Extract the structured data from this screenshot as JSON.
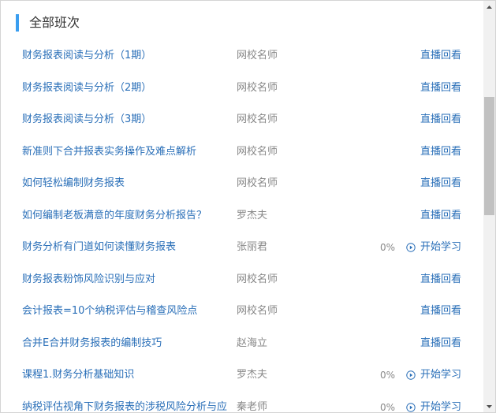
{
  "header": {
    "title": "全部班次"
  },
  "courses": [
    {
      "title": "财务报表阅读与分析（1期）",
      "teacher": "网校名师",
      "progress": "",
      "action": "直播回看",
      "action_type": "replay"
    },
    {
      "title": "财务报表阅读与分析（2期）",
      "teacher": "网校名师",
      "progress": "",
      "action": "直播回看",
      "action_type": "replay"
    },
    {
      "title": "财务报表阅读与分析（3期）",
      "teacher": "网校名师",
      "progress": "",
      "action": "直播回看",
      "action_type": "replay"
    },
    {
      "title": "新准则下合并报表实务操作及难点解析",
      "teacher": "网校名师",
      "progress": "",
      "action": "直播回看",
      "action_type": "replay"
    },
    {
      "title": "如何轻松编制财务报表",
      "teacher": "网校名师",
      "progress": "",
      "action": "直播回看",
      "action_type": "replay"
    },
    {
      "title": "如何编制老板满意的年度财务分析报告？",
      "teacher": "罗杰夫",
      "progress": "",
      "action": "直播回看",
      "action_type": "replay"
    },
    {
      "title": "财务分析有门道如何读懂财务报表",
      "teacher": "张丽君",
      "progress": "0%",
      "action": "开始学习",
      "action_type": "start"
    },
    {
      "title": "财务报表粉饰风险识别与应对",
      "teacher": "网校名师",
      "progress": "",
      "action": "直播回看",
      "action_type": "replay"
    },
    {
      "title": "会计报表=10个纳税评估与稽查风险点",
      "teacher": "网校名师",
      "progress": "",
      "action": "直播回看",
      "action_type": "replay"
    },
    {
      "title": "合并E合并财务报表的编制技巧",
      "teacher": "赵海立",
      "progress": "",
      "action": "直播回看",
      "action_type": "replay"
    },
    {
      "title": "课程1.财务分析基础知识",
      "teacher": "罗杰夫",
      "progress": "0%",
      "action": "开始学习",
      "action_type": "start"
    },
    {
      "title": "纳税评估视角下财务报表的涉税风险分析与应",
      "teacher": "秦老师",
      "progress": "0%",
      "action": "开始学习",
      "action_type": "start"
    }
  ],
  "colors": {
    "accent": "#3a9ef0",
    "link": "#2a6fb8",
    "muted": "#888888"
  },
  "icons": {
    "start": "play-circle-icon",
    "scroll_up": "triangle-up-icon",
    "scroll_down": "triangle-down-icon"
  }
}
